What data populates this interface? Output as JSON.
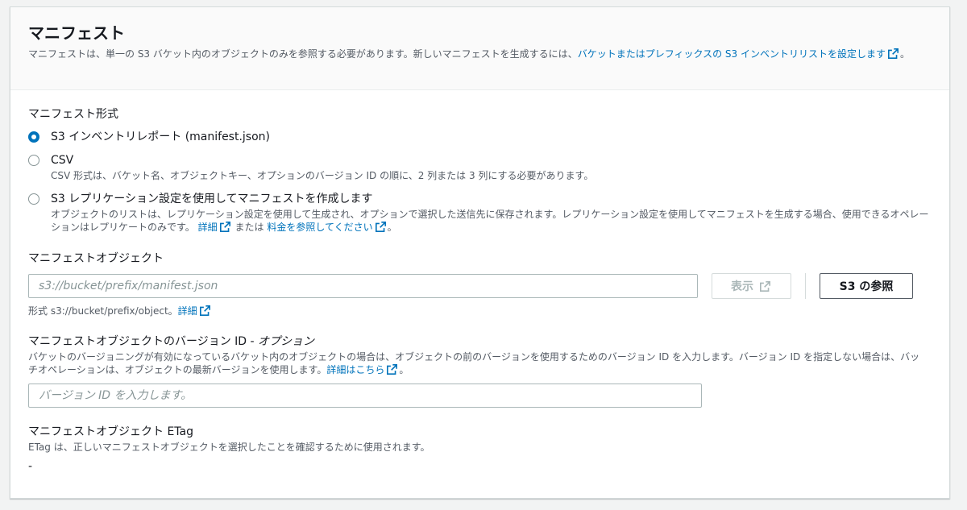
{
  "header": {
    "title": "マニフェスト",
    "desc_prefix": "マニフェストは、単一の S3 バケット内のオブジェクトのみを参照する必要があります。新しいマニフェストを生成するには、",
    "link": "バケットまたはプレフィックスの S3 インベントリリストを設定します",
    "desc_suffix": "。"
  },
  "format": {
    "label": "マニフェスト形式",
    "options": [
      {
        "label": "S3 インベントリレポート (manifest.json)",
        "selected": true
      },
      {
        "label": "CSV",
        "desc": "CSV 形式は、バケット名、オブジェクトキー、オプションのバージョン ID の順に、2 列または 3 列にする必要があります。"
      },
      {
        "label": "S3 レプリケーション設定を使用してマニフェストを作成します",
        "desc": "オブジェクトのリストは、レプリケーション設定を使用して生成され、オプションで選択した送信先に保存されます。レプリケーション設定を使用してマニフェストを生成する場合、使用できるオペレーションはレプリケートのみです。",
        "link1": "詳細",
        "mid": "または",
        "link2": "料金を参照してください",
        "suffix": "。"
      }
    ]
  },
  "object": {
    "label": "マニフェストオブジェクト",
    "placeholder": "s3://bucket/prefix/manifest.json",
    "view_button": "表示",
    "browse_button": "S3 の参照",
    "hint": "形式 s3://bucket/prefix/object。",
    "hint_link": "詳細"
  },
  "version": {
    "label": "マニフェストオブジェクトのバージョン ID - ",
    "label_optional": "オプション",
    "desc": "バケットのバージョニングが有効になっているバケット内のオブジェクトの場合は、オブジェクトの前のバージョンを使用するためのバージョン ID を入力します。バージョン ID を指定しない場合は、バッチオペレーションは、オブジェクトの最新バージョンを使用します。",
    "link": "詳細はこちら",
    "suffix": "。",
    "placeholder": "バージョン ID を入力します。"
  },
  "etag": {
    "label": "マニフェストオブジェクト ETag",
    "desc": "ETag は、正しいマニフェストオブジェクトを選択したことを確認するために使用されます。",
    "value": "-"
  },
  "colors": {
    "link": "#0073bb",
    "radio_selected": "#0073bb",
    "text": "#16191f",
    "secondary": "#545b64"
  }
}
